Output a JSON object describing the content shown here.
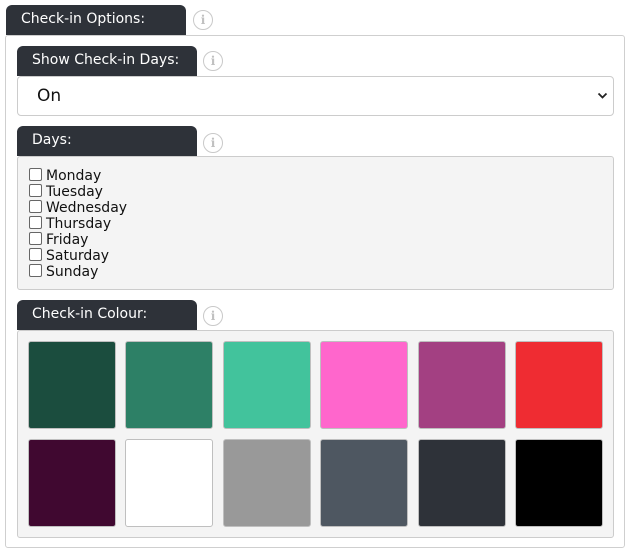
{
  "check_in_options": {
    "title": "Check-in Options:",
    "info_icon": "info-icon"
  },
  "show_days": {
    "title": "Show Check-in Days:",
    "selected": "On",
    "info_icon": "info-icon"
  },
  "days": {
    "title": "Days:",
    "info_icon": "info-icon",
    "items": [
      {
        "label": "Monday",
        "checked": false
      },
      {
        "label": "Tuesday",
        "checked": false
      },
      {
        "label": "Wednesday",
        "checked": false
      },
      {
        "label": "Thursday",
        "checked": false
      },
      {
        "label": "Friday",
        "checked": false
      },
      {
        "label": "Saturday",
        "checked": false
      },
      {
        "label": "Sunday",
        "checked": false
      }
    ]
  },
  "colour": {
    "title": "Check-in Colour:",
    "info_icon": "info-icon",
    "swatches": [
      "#1b4d3e",
      "#2d8066",
      "#42c39c",
      "#ff66cc",
      "#a34082",
      "#ef2c32",
      "#400830",
      "#ffffff",
      "#999999",
      "#4e5761",
      "#2e3239",
      "#000000"
    ]
  },
  "info_glyph": "i"
}
